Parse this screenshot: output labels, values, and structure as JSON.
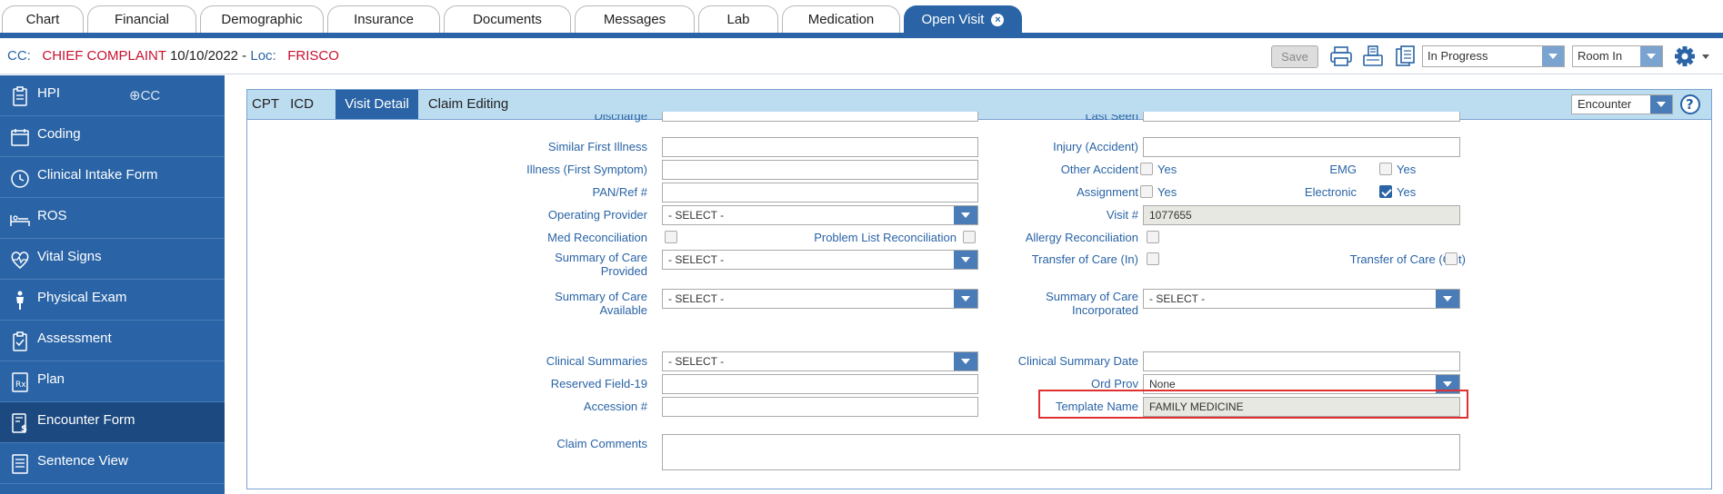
{
  "top_tabs": [
    "Chart",
    "Financial",
    "Demographic",
    "Insurance",
    "Documents",
    "Messages",
    "Lab",
    "Medication",
    "Open Visit"
  ],
  "header": {
    "cc_label": "CC:",
    "chief_complaint": "CHIEF COMPLAINT",
    "date": "10/10/2022",
    "dash": " - ",
    "loc_label": "Loc:",
    "location": "FRISCO",
    "save_label": "Save",
    "status_value": "In Progress",
    "room_value": "Room In"
  },
  "sidebar": {
    "cc_add_label": "CC",
    "items": [
      {
        "label": "HPI",
        "icon": "clipboard-icon"
      },
      {
        "label": "Coding",
        "icon": "calendar-icon"
      },
      {
        "label": "Clinical Intake Form",
        "icon": "clock-icon"
      },
      {
        "label": "ROS",
        "icon": "bed-icon"
      },
      {
        "label": "Vital Signs",
        "icon": "heartbeat-icon"
      },
      {
        "label": "Physical Exam",
        "icon": "person-icon"
      },
      {
        "label": "Assessment",
        "icon": "clipboard-check-icon"
      },
      {
        "label": "Plan",
        "icon": "prescription-icon"
      },
      {
        "label": "Encounter Form",
        "icon": "billing-icon"
      },
      {
        "label": "Sentence View",
        "icon": "document-icon"
      }
    ]
  },
  "subtabs": [
    "CPT",
    "ICD",
    "Visit Detail",
    "Claim Editing"
  ],
  "encounter_select": "Encounter",
  "form": {
    "discharge": "Discharge",
    "last_seen": "Last Seen",
    "similar_first_illness": "Similar First Illness",
    "injury_accident": "Injury (Accident)",
    "illness_first_symptom": "Illness (First Symptom)",
    "other_accident": "Other Accident",
    "emg": "EMG",
    "pan_ref": "PAN/Ref #",
    "assignment": "Assignment",
    "electronic": "Electronic",
    "operating_provider": "Operating Provider",
    "visit_no": "Visit #",
    "visit_no_value": "1077655",
    "med_reconciliation": "Med Reconciliation",
    "problem_list_reconciliation": "Problem List Reconciliation",
    "allergy_reconciliation": "Allergy Reconciliation",
    "summary_care_provided_1": "Summary of Care",
    "summary_care_provided_2": "Provided",
    "transfer_care_in": "Transfer of Care (In)",
    "transfer_care_out": "Transfer of Care (Out)",
    "summary_care_available_1": "Summary of Care",
    "summary_care_available_2": "Available",
    "summary_care_incorporated_1": "Summary of Care",
    "summary_care_incorporated_2": "Incorporated",
    "clinical_summaries": "Clinical Summaries",
    "clinical_summary_date": "Clinical Summary Date",
    "reserved_field_19": "Reserved Field-19",
    "ord_prov": "Ord Prov",
    "ord_prov_value": "None",
    "accession": "Accession #",
    "template_name": "Template Name",
    "template_name_value": "FAMILY MEDICINE",
    "claim_comments": "Claim Comments",
    "select_placeholder": "- SELECT -",
    "yes": "Yes"
  }
}
